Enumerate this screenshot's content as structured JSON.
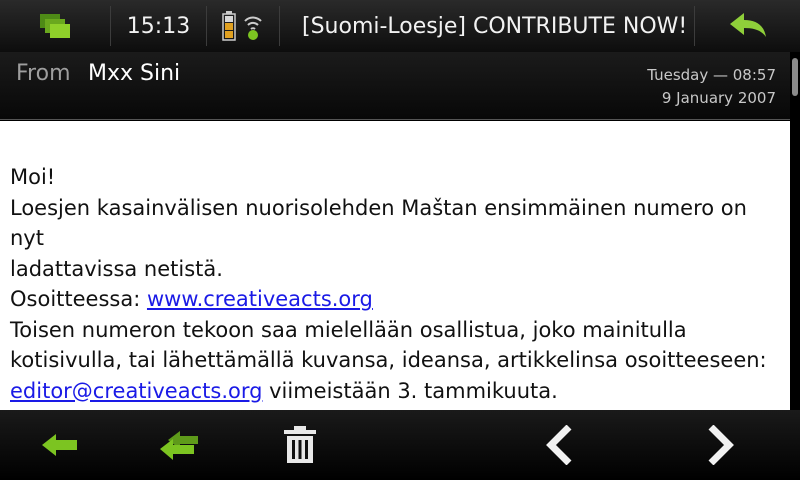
{
  "titlebar": {
    "clock": "15:13",
    "title": "[Suomi-Loesje] CONTRIBUTE NOW! Mas",
    "icons": {
      "switcher": "task-switcher-icon",
      "battery": "battery-icon",
      "connectivity": "wifi-icon",
      "back": "back-arrow-icon"
    }
  },
  "header": {
    "from_label": "From",
    "from_name": "Mxx Sini",
    "date_line1": "Tuesday — 08:57",
    "date_line2": "9 January 2007"
  },
  "message": {
    "greeting": "Moi!",
    "line1": "Loesjen kasainvälisen nuorisolehden Maštan ensimmäinen numero on",
    "line2": "nyt",
    "line3": "ladattavissa netistä.",
    "line4_prefix": "Osoitteessa: ",
    "link_web": "www.creativeacts.org",
    "line5": "Toisen numeron tekoon saa mielellään osallistua, joko mainitulla",
    "line6": "kotisivulla, tai lähettämällä kuvansa, ideansa, artikkelinsa osoitteeseen:",
    "link_email": "editor@creativeacts.org",
    "line7_suffix": " viimeistään 3. tammikuuta."
  },
  "toolbar": {
    "icons": [
      "reply-icon",
      "reply-all-icon",
      "delete-icon",
      "previous-icon",
      "next-icon"
    ],
    "accent": "#7cc421"
  }
}
